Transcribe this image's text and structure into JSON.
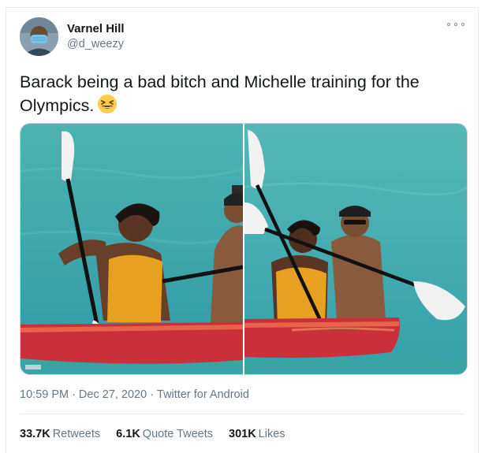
{
  "author": {
    "name": "Varnel Hill",
    "handle": "@d_weezy"
  },
  "tweet": {
    "text": "Barack being a bad bitch and Michelle training for the Olympics.",
    "emoji": "grinning-squinting-face-emoji"
  },
  "media": {
    "photo_count": 2,
    "colors": {
      "water": "#3fa9a8",
      "kayak": "#c9303a",
      "swimsuit": "#e7a020"
    }
  },
  "meta": {
    "time": "10:59 PM",
    "date": "Dec 27, 2020",
    "source": "Twitter for Android",
    "separator": "·"
  },
  "stats": {
    "retweets_count": "33.7K",
    "retweets_label": "Retweets",
    "quotes_count": "6.1K",
    "quotes_label": "Quote Tweets",
    "likes_count": "301K",
    "likes_label": "Likes"
  },
  "icons": {
    "more": "more-options-icon"
  },
  "theme": {
    "text": "#14171a",
    "muted": "#657786",
    "border": "#e6ecf0"
  }
}
